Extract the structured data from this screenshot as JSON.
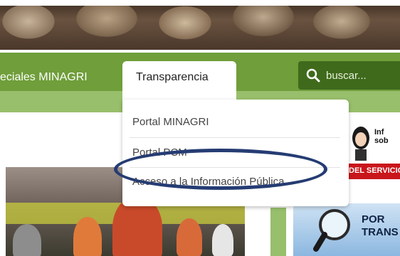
{
  "nav": {
    "item_left": "eciales MINAGRI",
    "active_tab": "Transparencia"
  },
  "search": {
    "placeholder": "buscar..."
  },
  "dropdown": {
    "items": [
      {
        "label": "Portal MINAGRI"
      },
      {
        "label": "Portal PCM"
      },
      {
        "label": "Acceso a la Información Pública"
      }
    ]
  },
  "ads": {
    "red_top": "Inf\nsob",
    "red_bar": "DEL SERVICIO",
    "blue_text": "POR\nTRANS"
  },
  "colors": {
    "nav_green": "#6f9e3a",
    "search_bg": "#3f6a1c",
    "highlight": "#253c73",
    "ad_red": "#c9161b"
  }
}
